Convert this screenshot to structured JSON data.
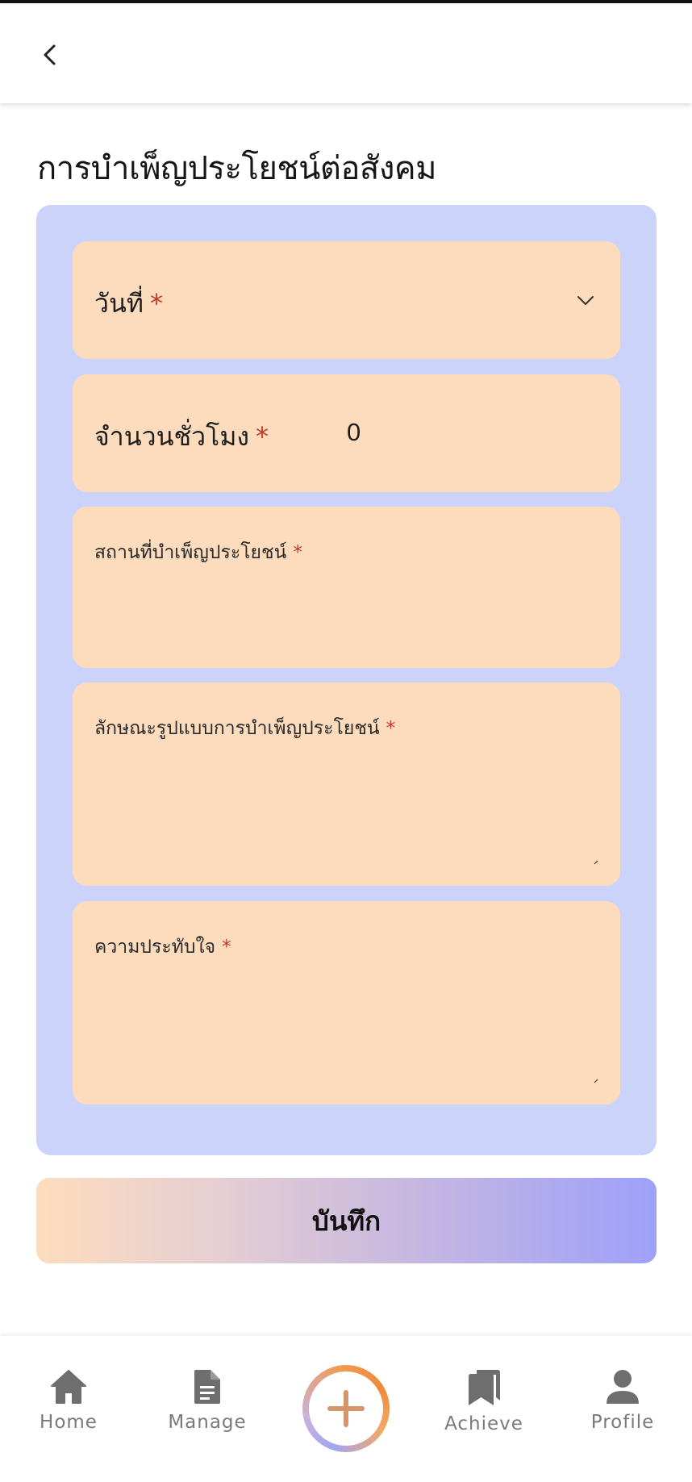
{
  "header": {
    "back_icon": "chevron-left-icon"
  },
  "page": {
    "title": "การบำเพ็ญประโยชน์ต่อสังคม"
  },
  "form": {
    "date": {
      "label": "วันที่",
      "required_mark": "*",
      "dropdown_icon": "chevron-down-icon"
    },
    "hours": {
      "label": "จำนวนชั่วโมง",
      "required_mark": "*",
      "value": "0"
    },
    "place": {
      "label": "สถานที่บำเพ็ญประโยชน์",
      "required_mark": "*",
      "value": ""
    },
    "style": {
      "label": "ลักษณะรูปแบบการบำเพ็ญประโยชน์",
      "required_mark": "*",
      "value": ""
    },
    "impression": {
      "label": "ความประทับใจ",
      "required_mark": "*",
      "value": ""
    }
  },
  "save_button": {
    "label": "บันทึก"
  },
  "bottom_nav": {
    "items": [
      {
        "label": "Home",
        "icon": "home-icon"
      },
      {
        "label": "Manage",
        "icon": "document-icon"
      },
      {
        "label": "",
        "icon": "plus-icon"
      },
      {
        "label": "Achieve",
        "icon": "bookmarks-icon"
      },
      {
        "label": "Profile",
        "icon": "person-icon"
      }
    ]
  },
  "colors": {
    "form_background": "#ccd3fb",
    "field_background": "#fddcbd",
    "required": "#c0392b",
    "nav_icon": "#6e6e6e",
    "fab_orange": "#ee8a3a",
    "fab_purple": "#a2a6f4",
    "plus_color": "#d4956b"
  }
}
